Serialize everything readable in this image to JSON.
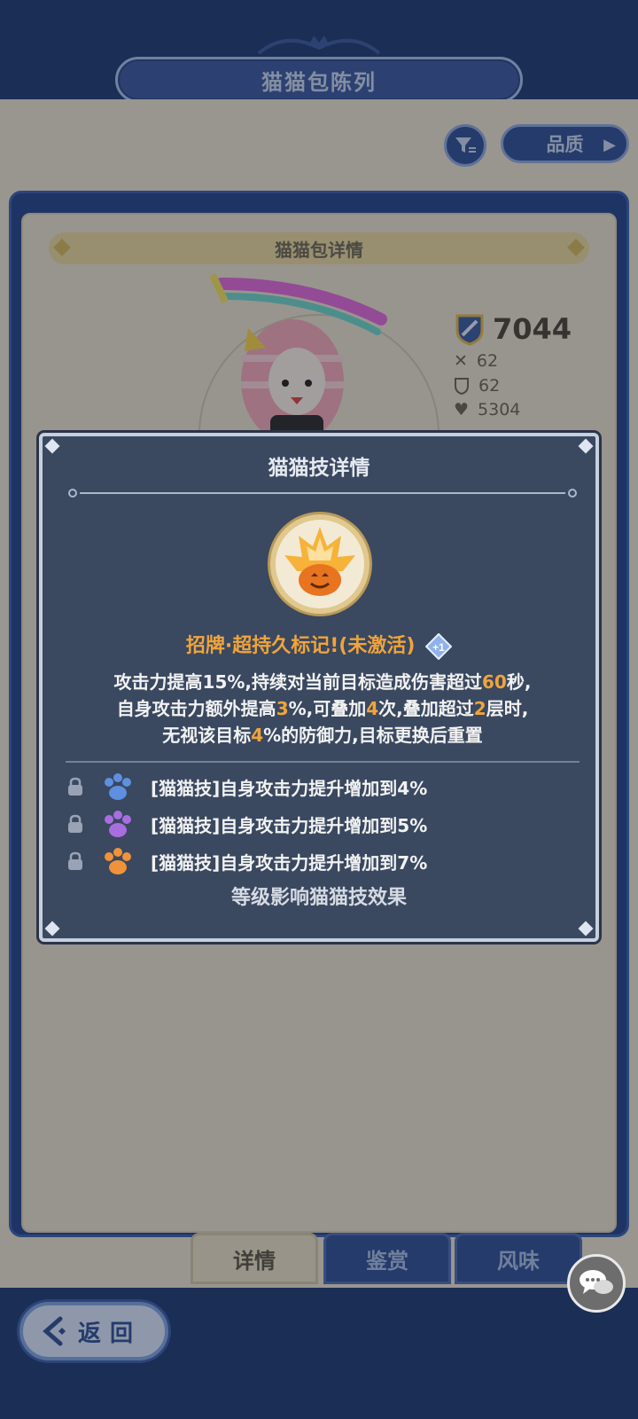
{
  "header": {
    "title": "猫猫包陈列"
  },
  "toolbar": {
    "filter_icon": "filter-icon",
    "quality_label": "品质"
  },
  "detail": {
    "header": "猫猫包详情",
    "power": "7044",
    "stats": {
      "attack": "62",
      "defense": "62",
      "hp": "5304"
    }
  },
  "modal": {
    "title": "猫猫技详情",
    "skill_name": "招牌·超持久标记!(未激活)",
    "plus_badge": "+1",
    "desc": {
      "l1_a": "攻击力提高15%,持续对当前目标造成伤害超过",
      "l1_hl": "60",
      "l1_b": "秒,",
      "l2_a": "自身攻击力额外提高",
      "l2_hl1": "3",
      "l2_b": "%,可叠加",
      "l2_hl2": "4",
      "l2_c": "次,叠加超过",
      "l2_hl3": "2",
      "l2_d": "层时,",
      "l3_a": "无视该目标",
      "l3_hl": "4",
      "l3_b": "%的防御力,目标更换后重置"
    },
    "upgrades": [
      {
        "text": "[猫猫技]自身攻击力提升增加到4%",
        "paw_color": "#5f8fe0"
      },
      {
        "text": "[猫猫技]自身攻击力提升增加到5%",
        "paw_color": "#a86ee0"
      },
      {
        "text": "[猫猫技]自身攻击力提升增加到7%",
        "paw_color": "#f0923a"
      }
    ],
    "footer": "等级影响猫猫技效果"
  },
  "tabs": [
    "详情",
    "鉴赏",
    "风味"
  ],
  "back_button": "返回",
  "colors": {
    "accent": "#f0a43a",
    "modal_bg": "#3a4860",
    "frame_blue": "#24448a"
  }
}
